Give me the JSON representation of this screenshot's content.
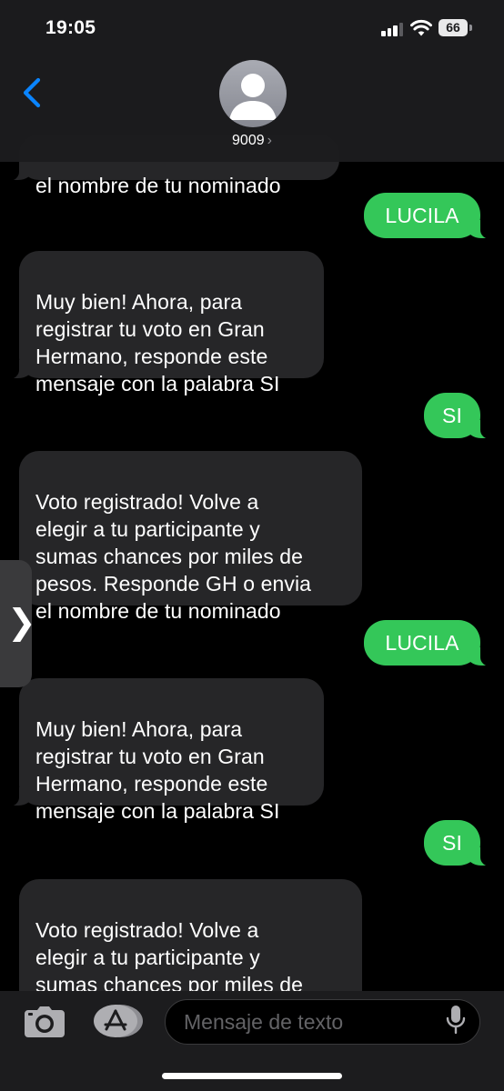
{
  "status_bar": {
    "time": "19:05",
    "battery": "66"
  },
  "header": {
    "contact_name": "9009",
    "contact_chevron": "›",
    "back_icon": "chevron-left-icon",
    "avatar_icon": "person-icon"
  },
  "messages": [
    {
      "direction": "incoming",
      "text": "el nombre de tu nominado"
    },
    {
      "direction": "outgoing",
      "text": "LUCILA"
    },
    {
      "direction": "incoming",
      "text": "Muy bien! Ahora, para\nregistrar tu voto en Gran\nHermano, responde este\nmensaje con la palabra SI"
    },
    {
      "direction": "outgoing",
      "text": "SI"
    },
    {
      "direction": "incoming",
      "text": "Voto registrado! Volve a\nelegir a tu participante y\nsumas chances por miles de\npesos. Responde GH o envia\nel nombre de tu nominado"
    },
    {
      "direction": "outgoing",
      "text": "LUCILA"
    },
    {
      "direction": "incoming",
      "text": "Muy bien! Ahora, para\nregistrar tu voto en Gran\nHermano, responde este\nmensaje con la palabra SI"
    },
    {
      "direction": "outgoing",
      "text": "SI"
    },
    {
      "direction": "incoming",
      "text": "Voto registrado! Volve a\nelegir a tu participante y\nsumas chances por miles de\npesos. Responde GH o envia"
    }
  ],
  "side_handle": {
    "glyph": "❯"
  },
  "composer": {
    "placeholder": "Mensaje de texto"
  },
  "colors": {
    "outgoing_bubble": "#34c759",
    "incoming_bubble": "#262628",
    "accent": "#0a84ff"
  }
}
